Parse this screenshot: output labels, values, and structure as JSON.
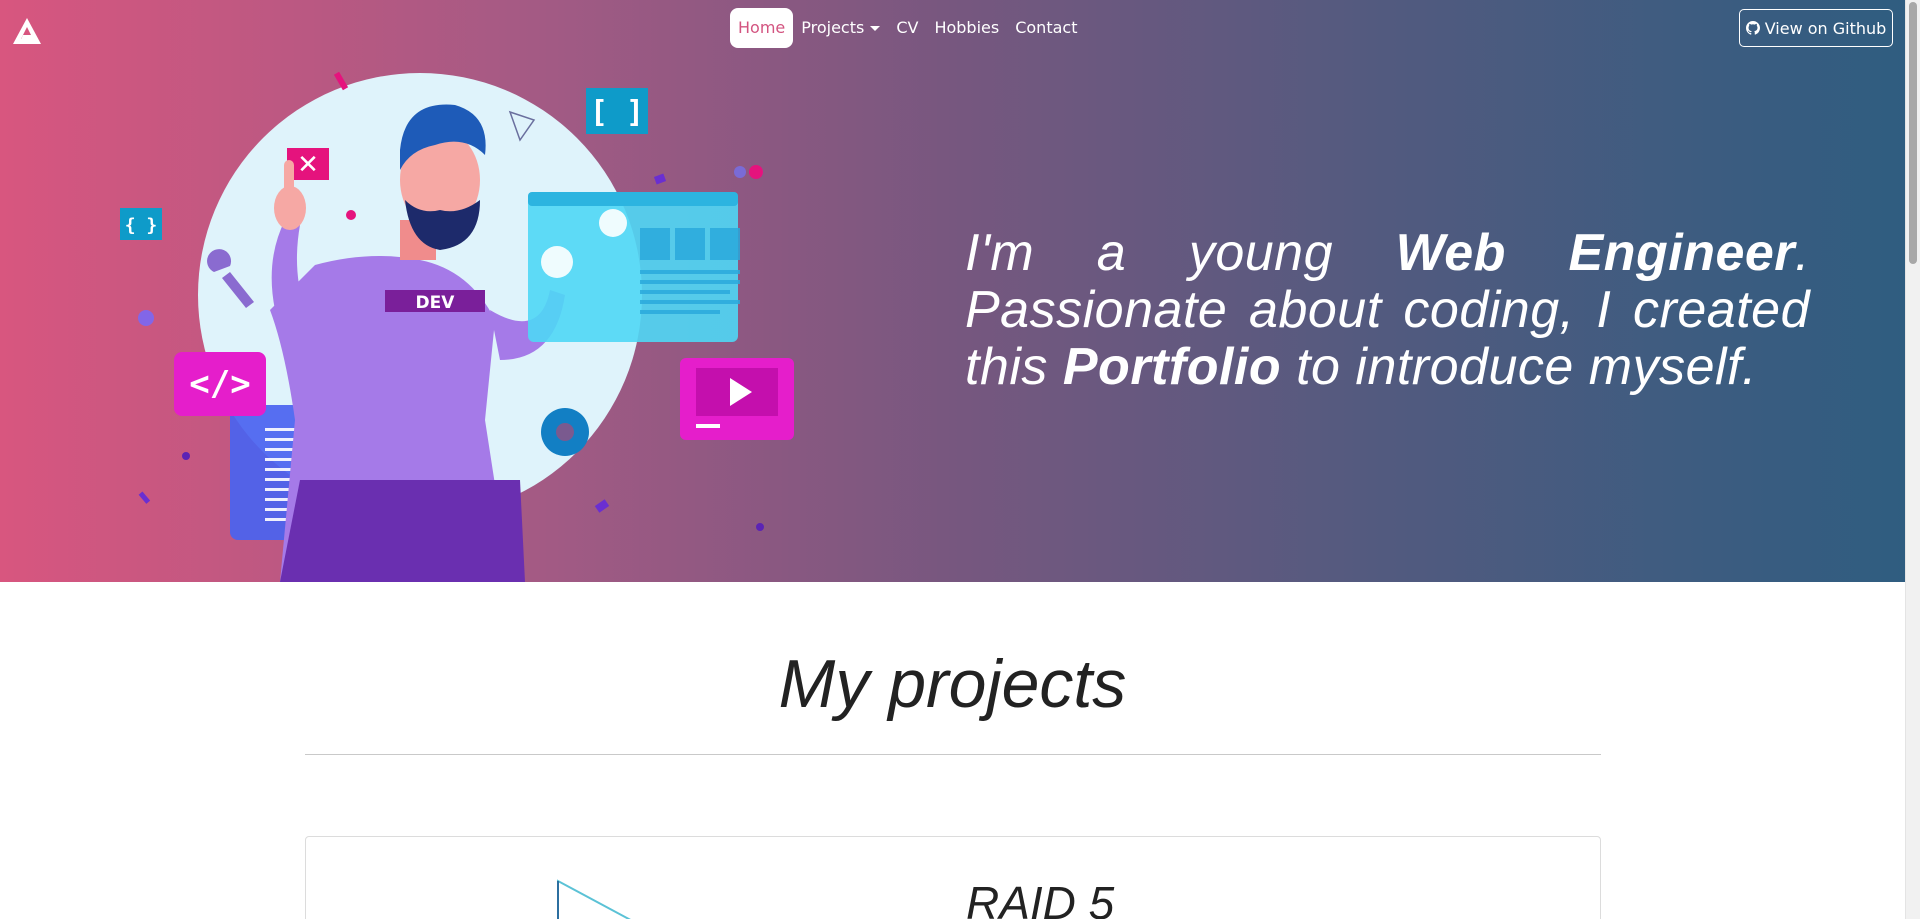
{
  "nav": {
    "items": [
      {
        "label": "Home",
        "active": true
      },
      {
        "label": "Projects",
        "dropdown": true
      },
      {
        "label": "CV"
      },
      {
        "label": "Hobbies"
      },
      {
        "label": "Contact"
      }
    ],
    "github_label": "View on Github"
  },
  "hero": {
    "text_1": "I'm a young ",
    "highlight_1": "Web Engineer",
    "text_2": ". Passionate about coding, I created this ",
    "highlight_2": "Portfolio",
    "text_3": " to introduce myself.",
    "illustration_badge": "DEV"
  },
  "projects": {
    "title": "My projects",
    "cards": [
      {
        "title": "RAID 5"
      }
    ]
  },
  "colors": {
    "gradient_start": "#d8567f",
    "gradient_end": "#2f5d80",
    "active_nav_text": "#d35480"
  }
}
